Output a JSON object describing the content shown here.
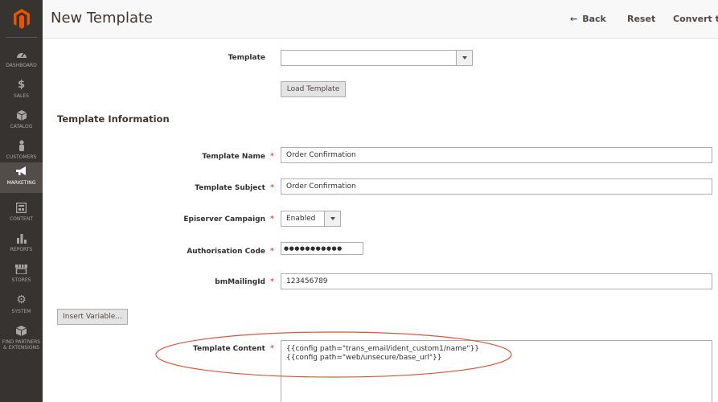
{
  "sidebar": {
    "logo": "magento-logo-icon",
    "items": [
      {
        "label": "DASHBOARD",
        "icon": "speedometer-icon"
      },
      {
        "label": "SALES",
        "icon": "dollar-icon"
      },
      {
        "label": "CATALOG",
        "icon": "cube-icon"
      },
      {
        "label": "CUSTOMERS",
        "icon": "person-icon"
      },
      {
        "label": "MARKETING",
        "icon": "megaphone-icon",
        "active": true
      },
      {
        "label": "CONTENT",
        "icon": "layout-icon"
      },
      {
        "label": "REPORTS",
        "icon": "bar-chart-icon"
      },
      {
        "label": "STORES",
        "icon": "store-icon"
      },
      {
        "label": "SYSTEM",
        "icon": "gear-icon"
      },
      {
        "label": "FIND PARTNERS\n& EXTENSIONS",
        "icon": "box-icon"
      }
    ]
  },
  "header": {
    "title": "New Template",
    "back_label": "Back",
    "reset_label": "Reset",
    "convert_label": "Convert to"
  },
  "form": {
    "template_label": "Template",
    "template_value": "",
    "load_button": "Load Template",
    "section_title": "Template Information",
    "template_name_label": "Template Name",
    "template_name_value": "Order Confirmation",
    "template_subject_label": "Template Subject",
    "template_subject_value": "Order Confirmation",
    "campaign_label": "Episerver Campaign",
    "campaign_value": "Enabled",
    "auth_label": "Authorisation Code",
    "auth_value": "●●●●●●●●●●●",
    "mailing_label": "bmMailingId",
    "mailing_value": "123456789",
    "insert_variable_button": "Insert Variable...",
    "content_label": "Template Content",
    "content_line1": "{{config path=\"trans_email/ident_custom1/name\"}}",
    "content_line2": "{{config path=\"web/unsecure/base_url\"}}",
    "required_marker": "*"
  },
  "colors": {
    "sidebar_bg": "#373330",
    "active_bg": "#524d49",
    "logo_orange": "#eb5202",
    "required_red": "#e22626",
    "annotation_red": "#e0533a"
  }
}
